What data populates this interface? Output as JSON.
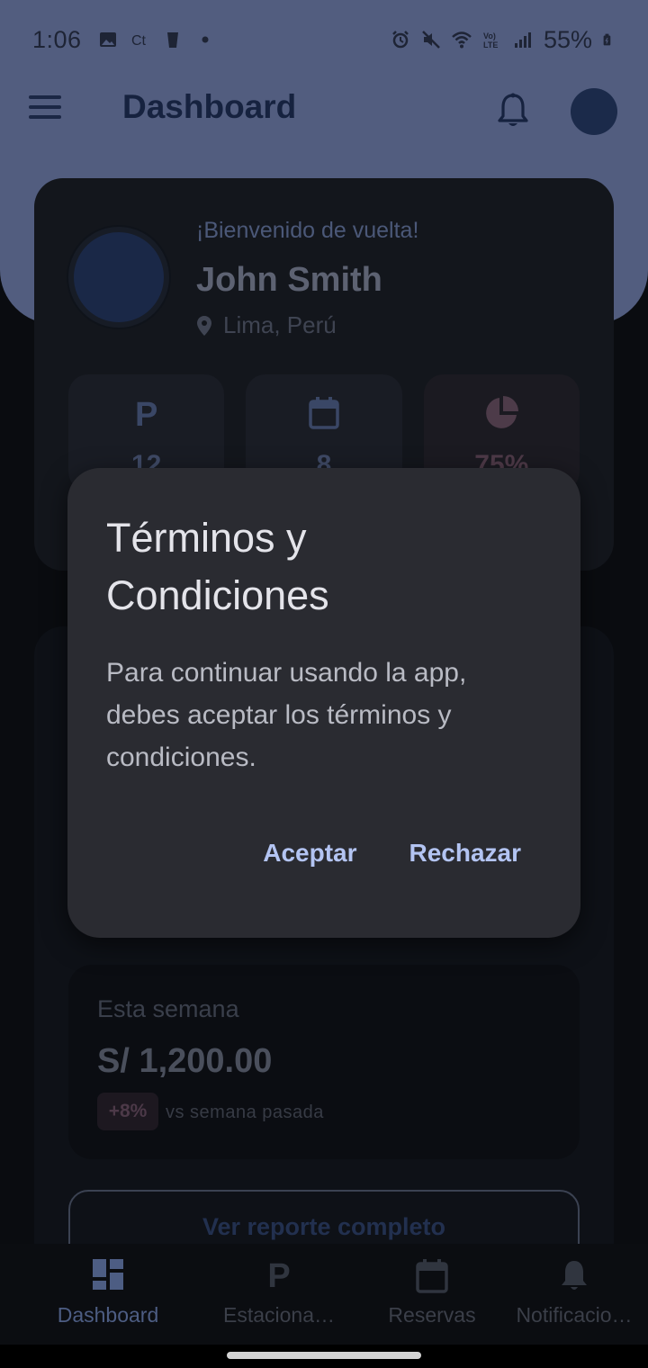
{
  "status_bar": {
    "time": "1:06",
    "battery_text": "55%"
  },
  "app_bar": {
    "title": "Dashboard"
  },
  "profile": {
    "welcome": "¡Bienvenido de vuelta!",
    "name": "John Smith",
    "location": "Lima, Perú"
  },
  "stats": [
    {
      "icon": "parking-icon",
      "value": "12"
    },
    {
      "icon": "calendar-icon",
      "value": "8"
    },
    {
      "icon": "pie-chart-icon",
      "value": "75%"
    }
  ],
  "week_summary": {
    "label": "Esta semana",
    "amount": "S/ 1,200.00",
    "change_badge": "+8%",
    "comparison": "vs semana pasada"
  },
  "report_button": {
    "label": "Ver reporte completo"
  },
  "dialog": {
    "title": "Términos y Condiciones",
    "body": "Para continuar usando la app, debes aceptar los términos y condiciones.",
    "accept_label": "Aceptar",
    "reject_label": "Rechazar"
  },
  "bottom_nav": {
    "items": [
      {
        "label": "Dashboard",
        "icon": "dashboard-icon",
        "active": true
      },
      {
        "label": "Estaciona…",
        "icon": "parking-icon",
        "active": false
      },
      {
        "label": "Reservas",
        "icon": "calendar-icon",
        "active": false
      },
      {
        "label": "Notificacio…",
        "icon": "bell-icon",
        "active": false
      }
    ]
  },
  "colors": {
    "header": "#525d7f",
    "background": "#0a0c10",
    "dialog": "#2a2b31",
    "dialog_action": "#b3c4f2"
  }
}
